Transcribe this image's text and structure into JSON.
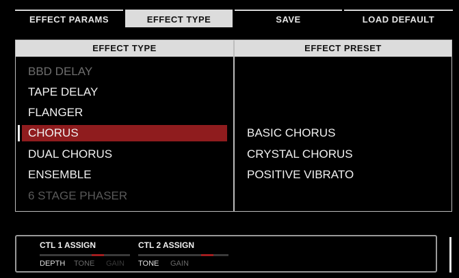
{
  "tabs": [
    {
      "label": "EFFECT PARAMS",
      "active": false
    },
    {
      "label": "EFFECT TYPE",
      "active": true
    },
    {
      "label": "SAVE",
      "active": false
    },
    {
      "label": "LOAD DEFAULT",
      "active": false
    }
  ],
  "effect_type": {
    "header": "EFFECT TYPE",
    "items": [
      {
        "label": "BBD DELAY",
        "state": "dim"
      },
      {
        "label": "TAPE DELAY",
        "state": "normal"
      },
      {
        "label": "FLANGER",
        "state": "normal"
      },
      {
        "label": "CHORUS",
        "state": "selected"
      },
      {
        "label": "DUAL CHORUS",
        "state": "normal"
      },
      {
        "label": "ENSEMBLE",
        "state": "normal"
      },
      {
        "label": "6 STAGE PHASER",
        "state": "dim"
      }
    ],
    "selected_color": "#8f1c1e"
  },
  "effect_preset": {
    "header": "EFFECT PRESET",
    "items": [
      "BASIC CHORUS",
      "CRYSTAL CHORUS",
      "POSITIVE VIBRATO"
    ]
  },
  "ctl_assign": [
    {
      "title": "CTL 1 ASSIGN",
      "options": [
        "DEPTH",
        "TONE",
        "GAIN"
      ],
      "selected": "DEPTH"
    },
    {
      "title": "CTL 2 ASSIGN",
      "options": [
        "TONE",
        "GAIN"
      ],
      "selected": "TONE"
    }
  ]
}
